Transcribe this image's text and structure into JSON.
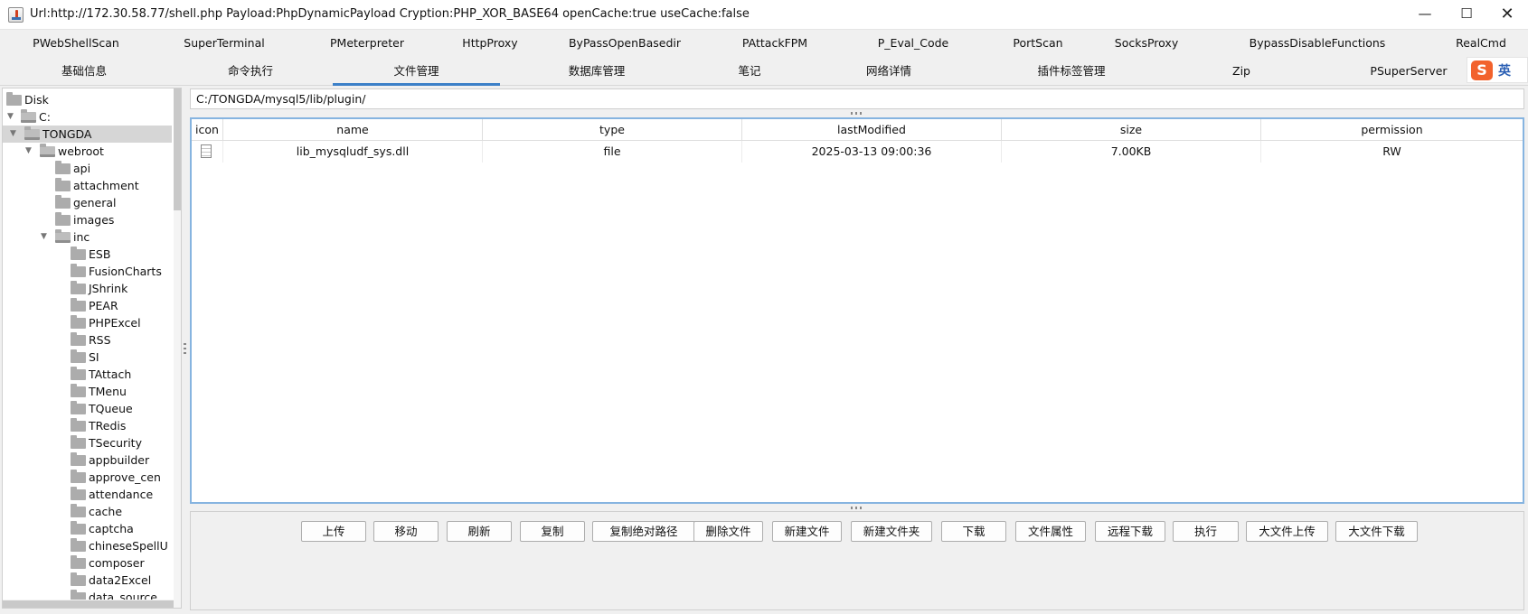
{
  "window": {
    "title": "Url:http://172.30.58.77/shell.php Payload:PhpDynamicPayload Cryption:PHP_XOR_BASE64 openCache:true useCache:false",
    "minimize_glyph": "—",
    "maximize_glyph": "☐",
    "close_glyph": "✕"
  },
  "tabs_row1": [
    "PWebShellScan",
    "SuperTerminal",
    "PMeterpreter",
    "HttpProxy",
    "ByPassOpenBasedir",
    "PAttackFPM",
    "P_Eval_Code",
    "PortScan",
    "SocksProxy",
    "BypassDisableFunctions",
    "RealCmd"
  ],
  "tabs_row2": [
    "基础信息",
    "命令执行",
    "文件管理",
    "数据库管理",
    "笔记",
    "网络详情",
    "插件标签管理",
    "Zip",
    "PSuperServer"
  ],
  "active_tab": "文件管理",
  "ime": {
    "logo": "S",
    "mode": "英"
  },
  "tree": {
    "selected": "TONGDA",
    "nodes": [
      {
        "label": "Disk",
        "depth": 0,
        "expanded": null
      },
      {
        "label": "C:",
        "depth": 0,
        "expanded": true
      },
      {
        "label": "TONGDA",
        "depth": 1,
        "expanded": true
      },
      {
        "label": "webroot",
        "depth": 2,
        "expanded": true
      },
      {
        "label": "api",
        "depth": 3,
        "expanded": null
      },
      {
        "label": "attachment",
        "depth": 3,
        "expanded": null
      },
      {
        "label": "general",
        "depth": 3,
        "expanded": null
      },
      {
        "label": "images",
        "depth": 3,
        "expanded": null
      },
      {
        "label": "inc",
        "depth": 3,
        "expanded": true
      },
      {
        "label": "ESB",
        "depth": 4,
        "expanded": null
      },
      {
        "label": "FusionCharts",
        "depth": 4,
        "expanded": null
      },
      {
        "label": "JShrink",
        "depth": 4,
        "expanded": null
      },
      {
        "label": "PEAR",
        "depth": 4,
        "expanded": null
      },
      {
        "label": "PHPExcel",
        "depth": 4,
        "expanded": null
      },
      {
        "label": "RSS",
        "depth": 4,
        "expanded": null
      },
      {
        "label": "SI",
        "depth": 4,
        "expanded": null
      },
      {
        "label": "TAttach",
        "depth": 4,
        "expanded": null
      },
      {
        "label": "TMenu",
        "depth": 4,
        "expanded": null
      },
      {
        "label": "TQueue",
        "depth": 4,
        "expanded": null
      },
      {
        "label": "TRedis",
        "depth": 4,
        "expanded": null
      },
      {
        "label": "TSecurity",
        "depth": 4,
        "expanded": null
      },
      {
        "label": "appbuilder",
        "depth": 4,
        "expanded": null
      },
      {
        "label": "approve_cen",
        "depth": 4,
        "expanded": null
      },
      {
        "label": "attendance",
        "depth": 4,
        "expanded": null
      },
      {
        "label": "cache",
        "depth": 4,
        "expanded": null
      },
      {
        "label": "captcha",
        "depth": 4,
        "expanded": null
      },
      {
        "label": "chineseSpellU",
        "depth": 4,
        "expanded": null
      },
      {
        "label": "composer",
        "depth": 4,
        "expanded": null
      },
      {
        "label": "data2Excel",
        "depth": 4,
        "expanded": null
      },
      {
        "label": "data_source",
        "depth": 4,
        "expanded": null
      }
    ]
  },
  "path": "C:/TONGDA/mysql5/lib/plugin/",
  "table": {
    "columns": [
      "icon",
      "name",
      "type",
      "lastModified",
      "size",
      "permission"
    ],
    "rows": [
      {
        "icon": "file-icon",
        "name": "lib_mysqludf_sys.dll",
        "type": "file",
        "lastModified": "2025-03-13 09:00:36",
        "size": "7.00KB",
        "permission": "RW"
      }
    ]
  },
  "buttons": [
    "上传",
    "移动",
    "刷新",
    "复制",
    "复制绝对路径",
    "删除文件",
    "新建文件",
    "新建文件夹",
    "下载",
    "文件属性",
    "远程下载",
    "执行",
    "大文件上传",
    "大文件下载"
  ]
}
